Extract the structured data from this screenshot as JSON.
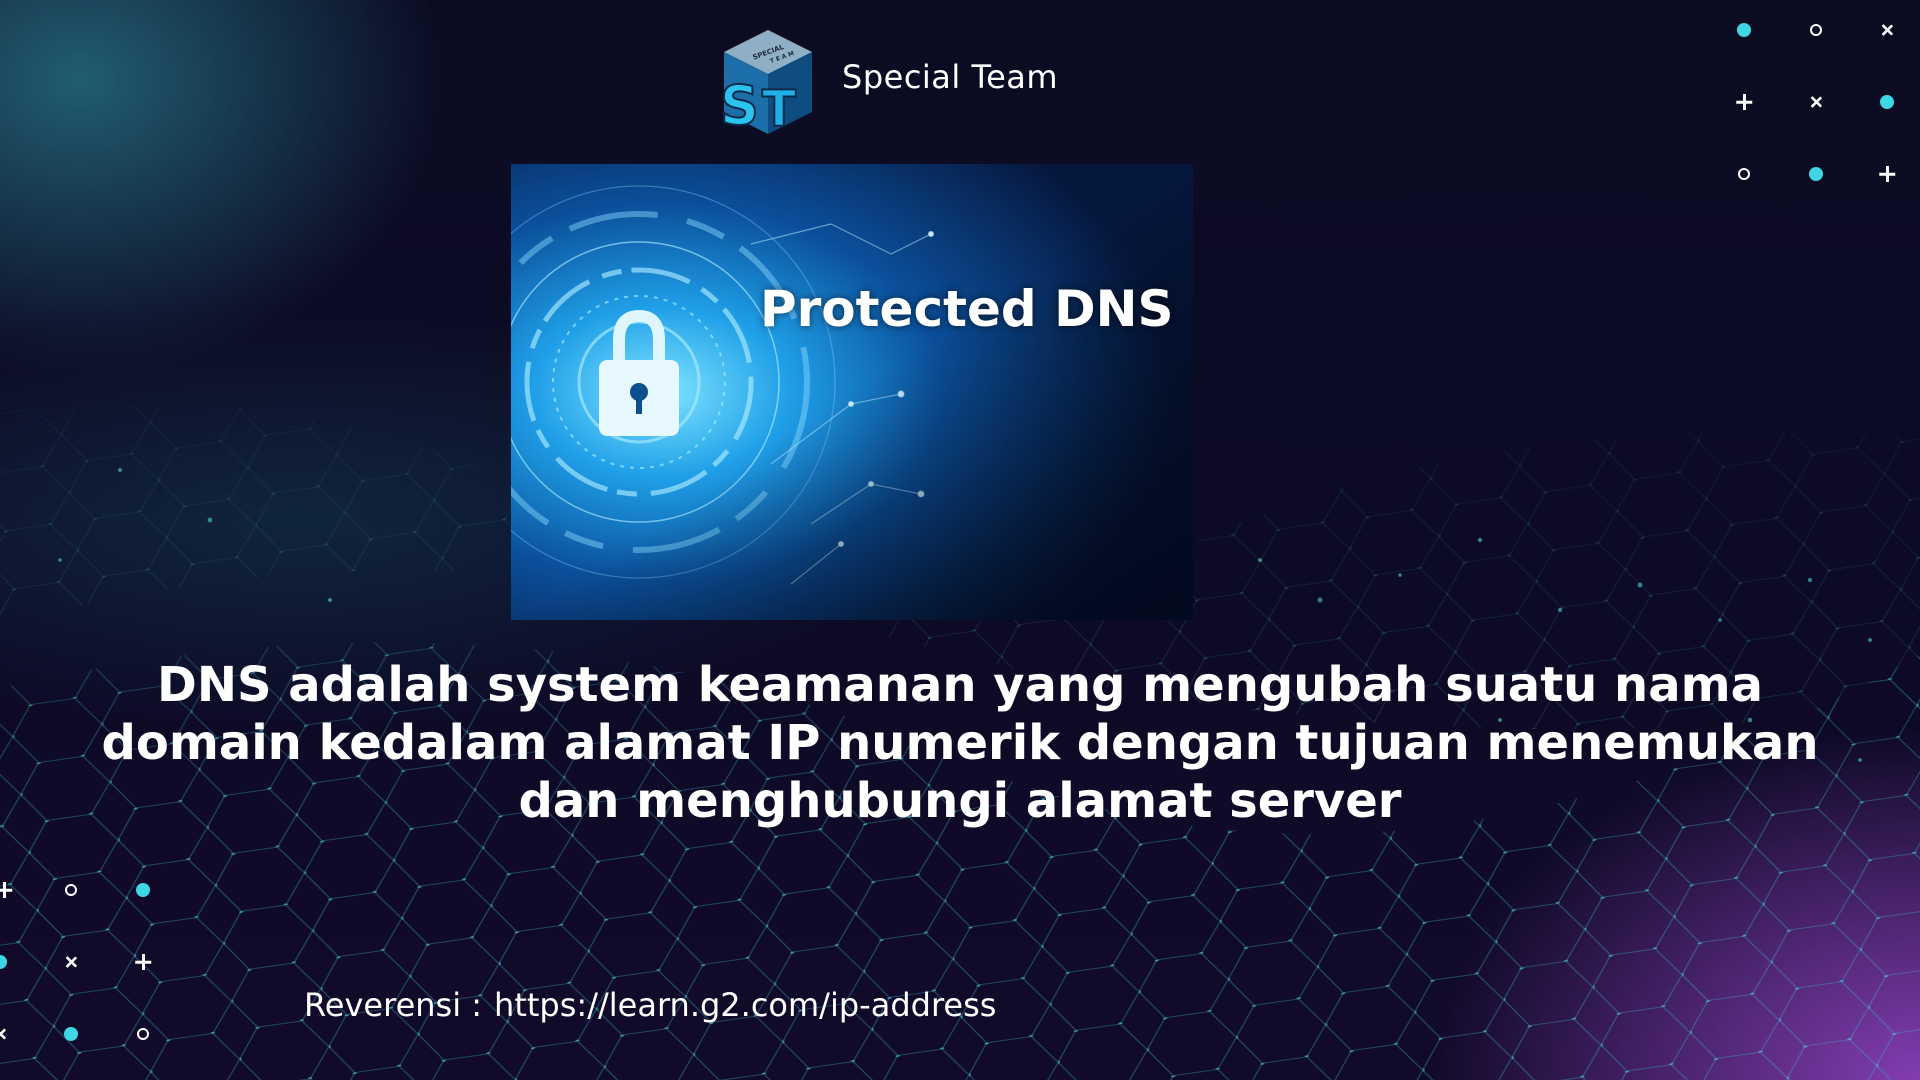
{
  "brand": {
    "name": "Special Team",
    "logo_text_top": "SPECIAL",
    "logo_text_mid": "TEAM",
    "logo_letters": "ST"
  },
  "hero": {
    "caption": "Protected DNS"
  },
  "body": {
    "lines": [
      "DNS adalah system keamanan yang mengubah suatu nama",
      "domain kedalam alamat IP numerik dengan tujuan menemukan",
      "dan menghubungi alamat server"
    ]
  },
  "reference": {
    "label": "Reverensi :",
    "url": "https://learn.g2.com/ip-address"
  },
  "colors": {
    "accent": "#3fd6e6",
    "background": "#0b0c22",
    "glow_purple": "#9646c8",
    "text": "#ffffff"
  },
  "icons": [
    "lock-icon",
    "cyan-dot-icon",
    "ring-icon",
    "plus-icon",
    "cross-icon"
  ]
}
